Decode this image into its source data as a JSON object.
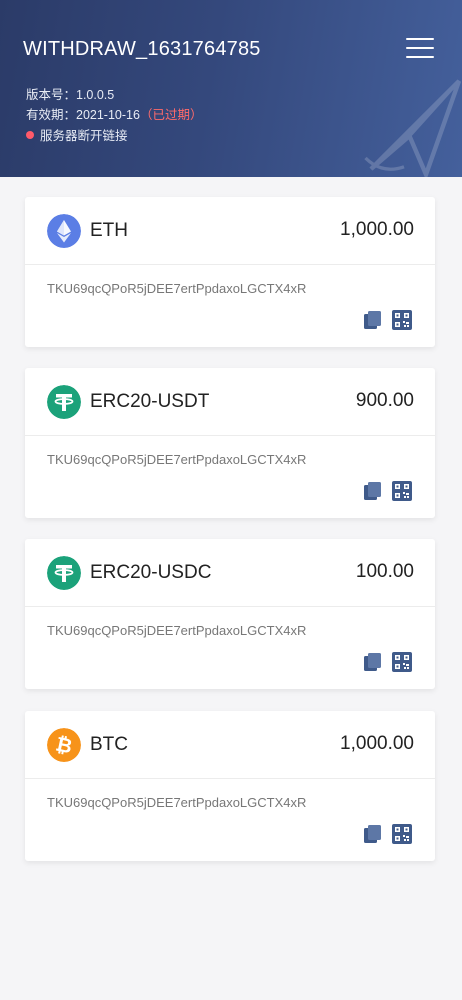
{
  "header": {
    "title": "WITHDRAW_1631764785",
    "version_label": "版本号：1.0.0.5",
    "expiry_label": "有效期：2021-10-16",
    "expiry_status": "（已过期）",
    "server_status": "服务器断开链接",
    "menu_icon": "hamburger-menu-icon"
  },
  "colors": {
    "header_start": "#2b3b68",
    "header_end": "#44609c",
    "expired": "#ff6b6b",
    "eth": "#5b7ee5",
    "usdt": "#1ba27a",
    "btc": "#f7931a",
    "action_icon": "#3f5a8a"
  },
  "cards": [
    {
      "name": "ETH",
      "amount": "1,000.00",
      "address": "TKU69qcQPoR5jDEE7ertPpdaxoLGCTX4xR",
      "icon": "eth-icon"
    },
    {
      "name": "ERC20-USDT",
      "amount": "900.00",
      "address": "TKU69qcQPoR5jDEE7ertPpdaxoLGCTX4xR",
      "icon": "usdt-icon"
    },
    {
      "name": "ERC20-USDC",
      "amount": "100.00",
      "address": "TKU69qcQPoR5jDEE7ertPpdaxoLGCTX4xR",
      "icon": "usdt-icon"
    },
    {
      "name": "BTC",
      "amount": "1,000.00",
      "address": "TKU69qcQPoR5jDEE7ertPpdaxoLGCTX4xR",
      "icon": "btc-icon"
    }
  ]
}
